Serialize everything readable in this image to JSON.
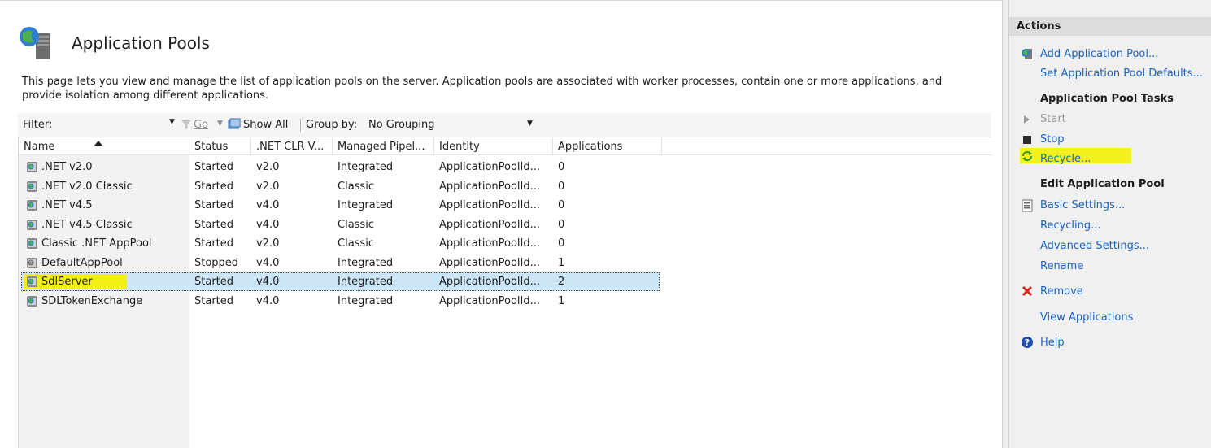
{
  "page": {
    "title": "Application Pools",
    "description": "This page lets you view and manage the list of application pools on the server. Application pools are associated with worker processes, contain one or more applications, and provide isolation among different applications."
  },
  "filterbar": {
    "filter_label": "Filter:",
    "go_label": "Go",
    "show_all_label": "Show All",
    "group_by_label": "Group by:",
    "group_by_value": "No Grouping"
  },
  "grid": {
    "columns": [
      "Name",
      "Status",
      ".NET CLR V...",
      "Managed Pipel...",
      "Identity",
      "Applications"
    ],
    "rows": [
      {
        "name": ".NET v2.0",
        "status": "Started",
        "clr": "v2.0",
        "pipeline": "Integrated",
        "identity": "ApplicationPoolId...",
        "apps": "0"
      },
      {
        "name": ".NET v2.0 Classic",
        "status": "Started",
        "clr": "v2.0",
        "pipeline": "Classic",
        "identity": "ApplicationPoolId...",
        "apps": "0"
      },
      {
        "name": ".NET v4.5",
        "status": "Started",
        "clr": "v4.0",
        "pipeline": "Integrated",
        "identity": "ApplicationPoolId...",
        "apps": "0"
      },
      {
        "name": ".NET v4.5 Classic",
        "status": "Started",
        "clr": "v4.0",
        "pipeline": "Classic",
        "identity": "ApplicationPoolId...",
        "apps": "0"
      },
      {
        "name": "Classic .NET AppPool",
        "status": "Started",
        "clr": "v2.0",
        "pipeline": "Classic",
        "identity": "ApplicationPoolId...",
        "apps": "0"
      },
      {
        "name": "DefaultAppPool",
        "status": "Stopped",
        "clr": "v4.0",
        "pipeline": "Integrated",
        "identity": "ApplicationPoolId...",
        "apps": "1"
      },
      {
        "name": "SdlServer",
        "status": "Started",
        "clr": "v4.0",
        "pipeline": "Integrated",
        "identity": "ApplicationPoolId...",
        "apps": "2"
      },
      {
        "name": "SDLTokenExchange",
        "status": "Started",
        "clr": "v4.0",
        "pipeline": "Integrated",
        "identity": "ApplicationPoolId...",
        "apps": "1"
      }
    ],
    "selected_row": "SdlServer"
  },
  "actions": {
    "title": "Actions",
    "add_pool": "Add Application Pool...",
    "set_defaults": "Set Application Pool Defaults...",
    "tasks_heading": "Application Pool Tasks",
    "start": "Start",
    "stop": "Stop",
    "recycle": "Recycle...",
    "edit_heading": "Edit Application Pool",
    "basic_settings": "Basic Settings...",
    "recycling": "Recycling...",
    "advanced_settings": "Advanced Settings...",
    "rename": "Rename",
    "remove": "Remove",
    "view_apps": "View Applications",
    "help": "Help"
  },
  "colors": {
    "link": "#1a63bd",
    "highlight": "#f2ef14",
    "selection": "#cde6f7",
    "remove_x": "#d0281f"
  }
}
